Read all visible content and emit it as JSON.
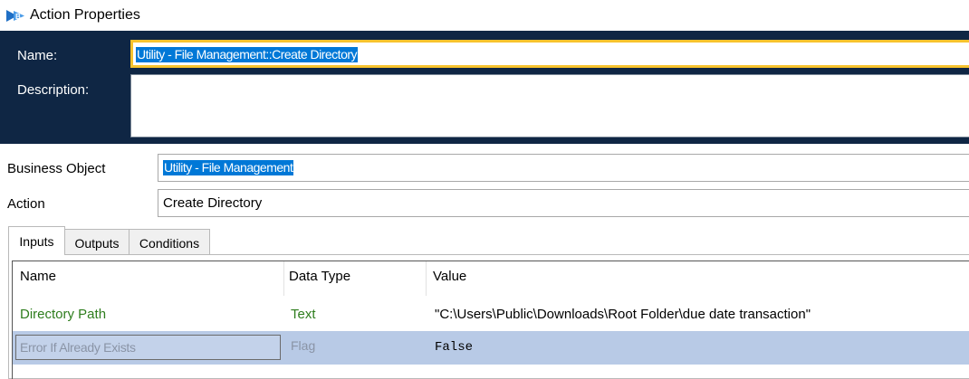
{
  "window": {
    "title": "Action Properties",
    "icon": "blueprism-icon"
  },
  "header": {
    "name_label": "Name:",
    "name_value": "Utility - File Management::Create Directory",
    "description_label": "Description:",
    "description_value": ""
  },
  "fields": {
    "business_object_label": "Business Object",
    "business_object_value": "Utility - File Management",
    "action_label": "Action",
    "action_value": "Create Directory"
  },
  "tabs": [
    {
      "label": "Inputs",
      "active": true
    },
    {
      "label": "Outputs",
      "active": false
    },
    {
      "label": "Conditions",
      "active": false
    }
  ],
  "grid": {
    "columns": [
      "Name",
      "Data Type",
      "Value"
    ],
    "rows": [
      {
        "name": "Directory Path",
        "type": "Text",
        "value": "\"C:\\Users\\Public\\Downloads\\Root Folder\\due date transaction\""
      },
      {
        "name": "Error If Already Exists",
        "type": "Flag",
        "value": "False"
      }
    ]
  },
  "colors": {
    "header_bg": "#0f2644",
    "name_border": "#f7c32e",
    "selection": "#0078d7",
    "selected_row": "#b8cae6",
    "text_type": "#2e7d1d"
  }
}
